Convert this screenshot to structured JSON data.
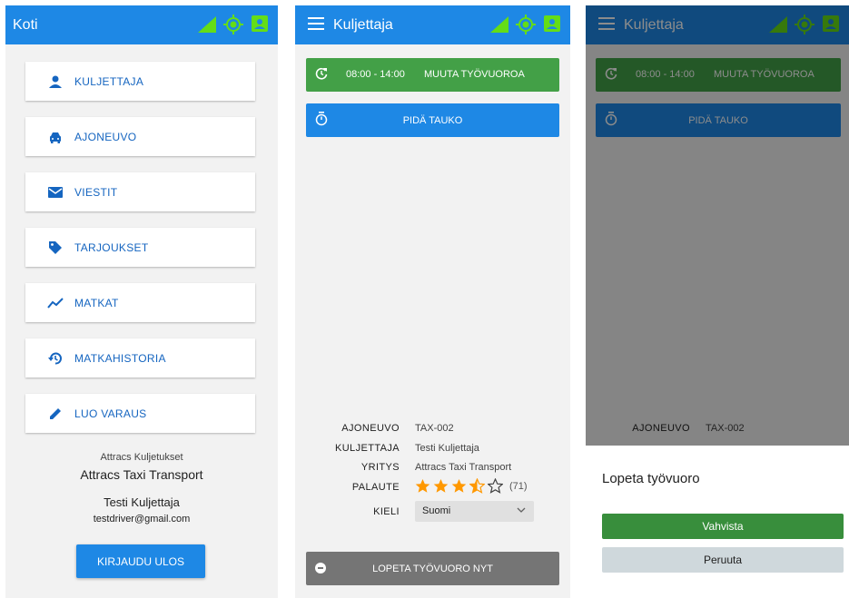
{
  "colors": {
    "primary": "#1e88e5",
    "shift_green": "#43a047",
    "status_green": "#64dd17",
    "star_orange": "#ff9800",
    "end_gray": "#757575",
    "confirm_green": "#388e3c",
    "cancel_gray": "#cfd8dc"
  },
  "home": {
    "title": "Koti",
    "menu": [
      {
        "label": "KULJETTAJA",
        "icon": "person-icon"
      },
      {
        "label": "AJONEUVO",
        "icon": "car-icon"
      },
      {
        "label": "VIESTIT",
        "icon": "mail-icon"
      },
      {
        "label": "TARJOUKSET",
        "icon": "tag-icon"
      },
      {
        "label": "MATKAT",
        "icon": "trending-icon"
      },
      {
        "label": "MATKAHISTORIA",
        "icon": "history-icon"
      },
      {
        "label": "LUO VARAUS",
        "icon": "pencil-icon"
      }
    ],
    "company_group": "Attracs Kuljetukset",
    "company_name": "Attracs Taxi Transport",
    "driver_name": "Testi Kuljettaja",
    "driver_email": "testdriver@gmail.com",
    "logout": "KIRJAUDU ULOS"
  },
  "driver": {
    "title": "Kuljettaja",
    "shift_time": "08:00 - 14:00",
    "change_shift": "MUUTA TYÖVUOROA",
    "take_break": "PIDÄ TAUKO",
    "info": {
      "vehicle_label": "AJONEUVO",
      "vehicle_value": "TAX-002",
      "driver_label": "KULJETTAJA",
      "driver_value": "Testi Kuljettaja",
      "company_label": "YRITYS",
      "company_value": "Attracs Taxi Transport",
      "feedback_label": "PALAUTE",
      "rating": 3.5,
      "rating_max": 5,
      "feedback_count": "(71)",
      "language_label": "KIELI",
      "language_value": "Suomi"
    },
    "end_shift_now": "LOPETA TYÖVUORO NYT"
  },
  "dialog": {
    "title": "Kuljettaja",
    "shift_time": "08:00 - 14:00",
    "change_shift": "MUUTA TYÖVUOROA",
    "take_break": "PIDÄ TAUKO",
    "vehicle_label": "AJONEUVO",
    "vehicle_value": "TAX-002",
    "sheet_title": "Lopeta työvuoro",
    "confirm": "Vahvista",
    "cancel": "Peruuta"
  }
}
